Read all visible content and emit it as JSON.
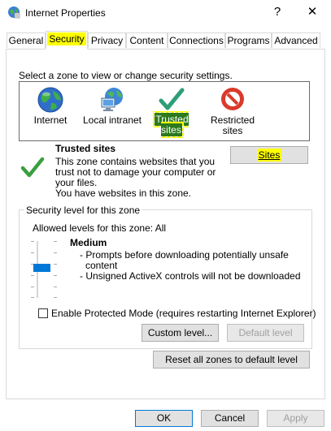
{
  "window": {
    "title": "Internet Properties",
    "help_glyph": "?",
    "close_glyph": "✕"
  },
  "tabs": [
    {
      "label": "General"
    },
    {
      "label": "Security",
      "active": true
    },
    {
      "label": "Privacy"
    },
    {
      "label": "Content"
    },
    {
      "label": "Connections"
    },
    {
      "label": "Programs"
    },
    {
      "label": "Advanced"
    }
  ],
  "zones": {
    "prompt": "Select a zone to view or change security settings.",
    "items": [
      {
        "label": "Internet",
        "icon": "globe-icon"
      },
      {
        "label": "Local intranet",
        "icon": "computer-network-icon"
      },
      {
        "label": "Trusted sites",
        "icon": "checkmark-icon",
        "selected": true
      },
      {
        "label_line1": "Restricted",
        "label_line2": "sites",
        "icon": "prohibited-icon"
      }
    ]
  },
  "zone_info": {
    "title": "Trusted sites",
    "desc1": "This zone contains websites that you",
    "desc2": "trust not to damage your computer or",
    "desc3": "your files.",
    "desc4": "You have websites in this zone.",
    "sites_button": "Sites"
  },
  "security_level": {
    "legend": "Security level for this zone",
    "allowed": "Allowed levels for this zone: All",
    "level_name": "Medium",
    "bullet1a": "- Prompts before downloading potentially unsafe",
    "bullet1b": "content",
    "bullet2": "- Unsigned ActiveX controls will not be downloaded",
    "slider_level": "Medium",
    "protected_mode_label": "Enable Protected Mode (requires restarting Internet Explorer)",
    "protected_mode_checked": false,
    "custom_button": "Custom level...",
    "default_button": "Default level"
  },
  "reset_button": "Reset all zones to default level",
  "footer": {
    "ok": "OK",
    "cancel": "Cancel",
    "apply": "Apply"
  },
  "colors": {
    "highlight": "#ffff00",
    "accent": "#0078d7",
    "check_green": "#2e9e3e"
  }
}
